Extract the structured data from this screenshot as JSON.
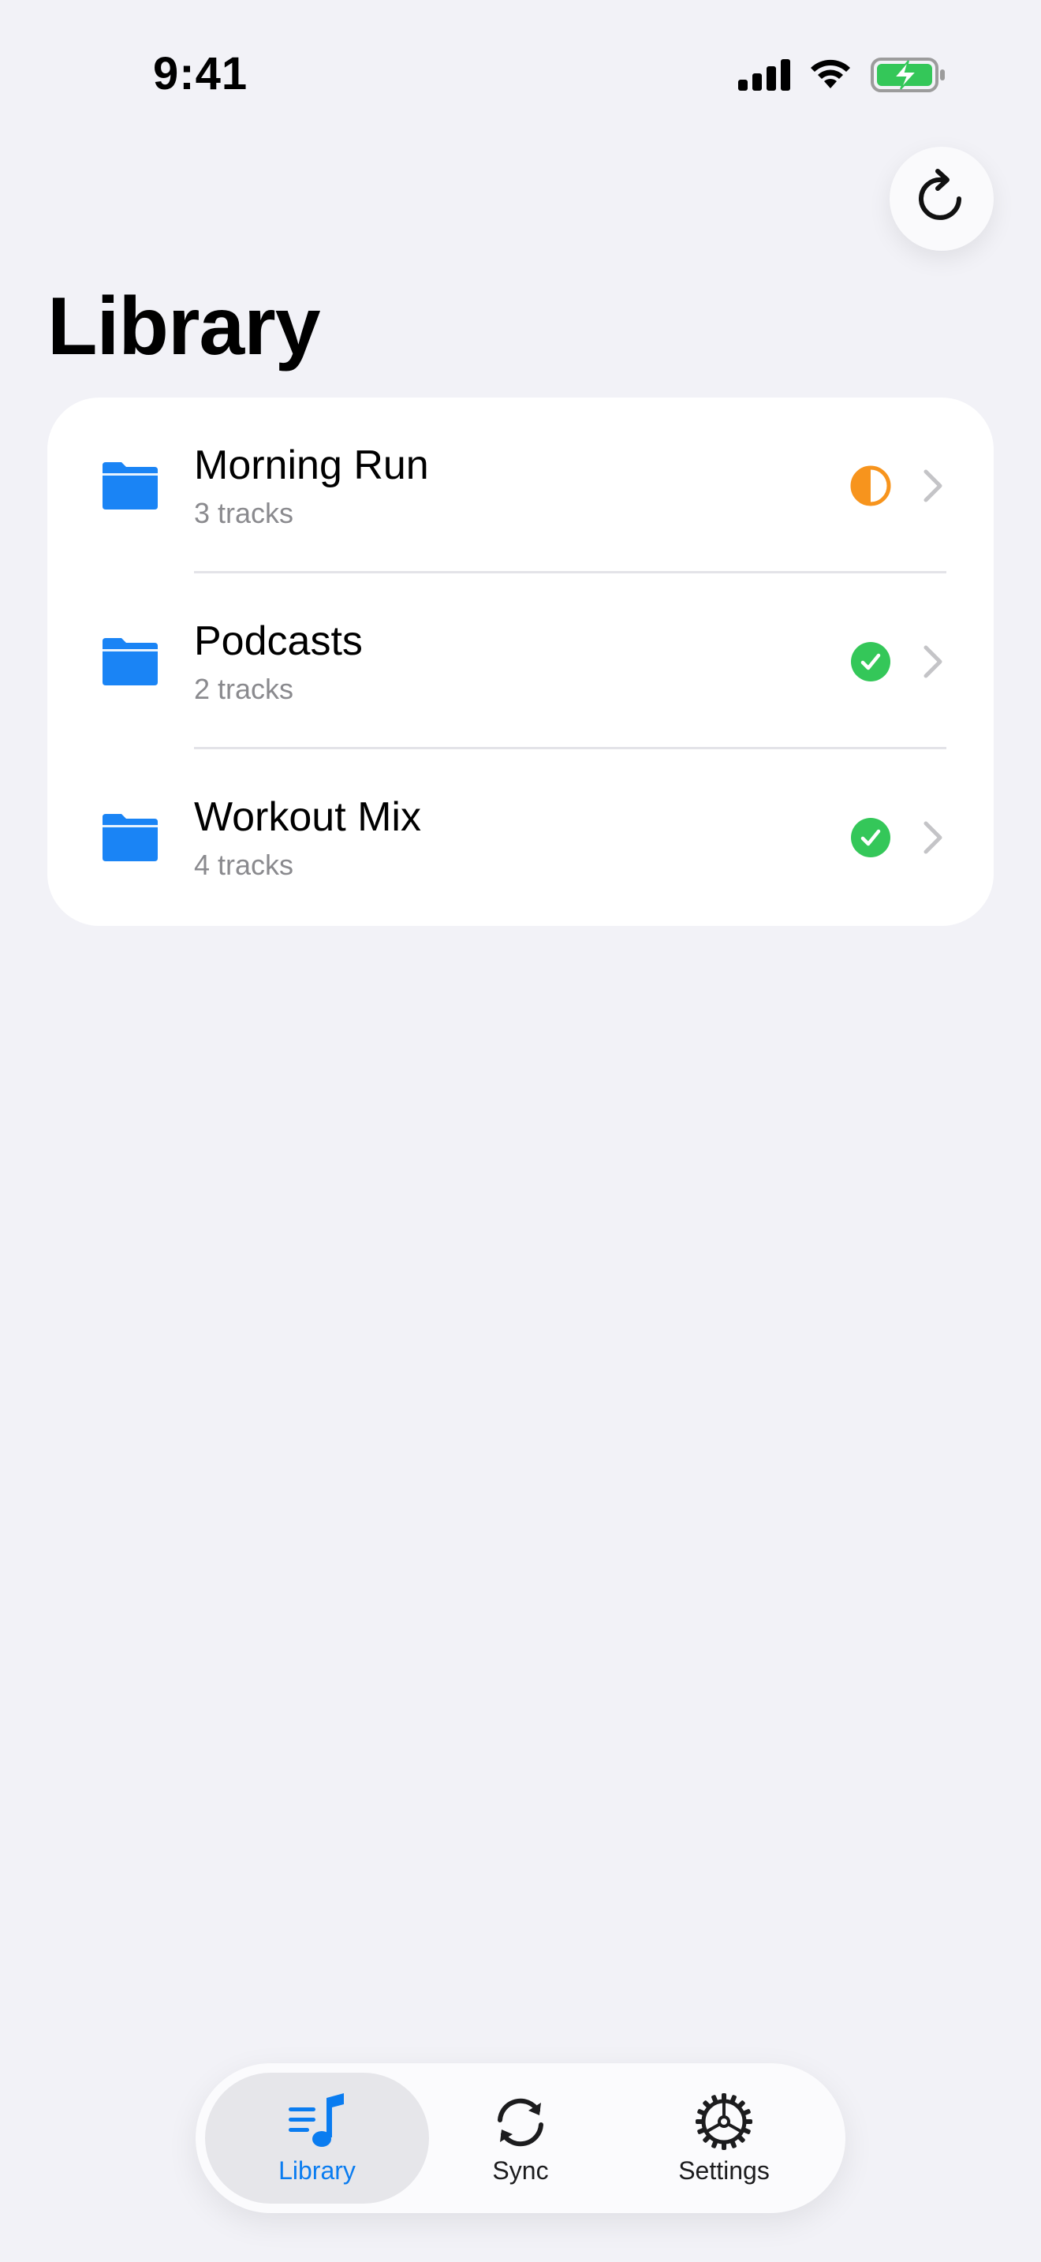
{
  "status_bar": {
    "time": "9:41",
    "icons": [
      "cellular-signal-icon",
      "wifi-icon",
      "battery-charging-icon"
    ]
  },
  "toolbar": {
    "refresh_icon": "refresh-icon"
  },
  "page": {
    "title": "Library"
  },
  "folders": [
    {
      "name": "Morning Run",
      "track_count": "3 tracks",
      "sync_status": "partial",
      "icon": "folder-icon",
      "status_color": "#f7941d"
    },
    {
      "name": "Podcasts",
      "track_count": "2 tracks",
      "sync_status": "synced",
      "icon": "folder-icon",
      "status_color": "#34c759"
    },
    {
      "name": "Workout Mix",
      "track_count": "4 tracks",
      "sync_status": "synced",
      "icon": "folder-icon",
      "status_color": "#34c759"
    }
  ],
  "tab_bar": {
    "tabs": [
      {
        "label": "Library",
        "icon": "music-library-icon",
        "selected": true
      },
      {
        "label": "Sync",
        "icon": "sync-arrows-icon",
        "selected": false
      },
      {
        "label": "Settings",
        "icon": "gear-icon",
        "selected": false
      }
    ]
  },
  "colors": {
    "accent": "#0a7cf0",
    "folder_blue": "#1a84f5",
    "synced_green": "#34c759",
    "partial_orange": "#f7941d",
    "background": "#f2f2f7"
  }
}
